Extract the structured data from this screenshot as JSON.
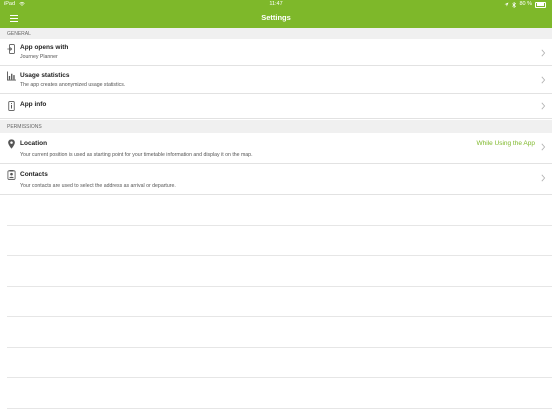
{
  "status_bar": {
    "device": "iPad",
    "time": "11:47",
    "battery": "80 %"
  },
  "nav": {
    "title": "Settings",
    "menu_icon": "hamburger-menu-icon"
  },
  "colors": {
    "accent": "#7eb82a",
    "section_bg": "#f0f0f0"
  },
  "sections": [
    {
      "header": "GENERAL",
      "rows": [
        {
          "icon": "app-open-icon",
          "label": "App opens with",
          "sub": "Journey Planner"
        },
        {
          "icon": "bar-chart-icon",
          "label": "Usage statistics",
          "sub": "The app creates anonymized usage statistics."
        },
        {
          "icon": "info-icon",
          "label": "App info"
        }
      ]
    },
    {
      "header": "PERMISSIONS",
      "rows": [
        {
          "icon": "location-pin-icon",
          "label": "Location",
          "value": "While Using the App",
          "sub": "Your current position is used as starting point for your timetable information and display it on the map."
        },
        {
          "icon": "contacts-icon",
          "label": "Contacts",
          "sub": "Your contacts are used to select the address as arrival or departure."
        }
      ]
    }
  ]
}
